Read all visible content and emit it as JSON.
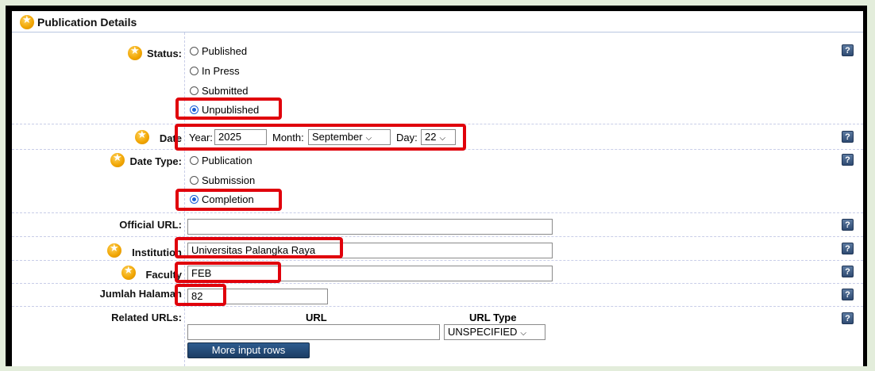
{
  "panel": {
    "title": "Publication Details"
  },
  "fields": {
    "status": {
      "label": "Status:",
      "options": [
        "Published",
        "In Press",
        "Submitted",
        "Unpublished"
      ],
      "selected": "Unpublished"
    },
    "date": {
      "label": "Date",
      "year_label": "Year:",
      "year_value": "2025",
      "month_label": "Month:",
      "month_value": "September",
      "day_label": "Day:",
      "day_value": "22"
    },
    "date_type": {
      "label": "Date Type:",
      "options": [
        "Publication",
        "Submission",
        "Completion"
      ],
      "selected": "Completion"
    },
    "official_url": {
      "label": "Official URL:",
      "value": ""
    },
    "institution": {
      "label": "Institution",
      "value": "Universitas Palangka Raya"
    },
    "faculty": {
      "label": "Faculty",
      "value": "FEB"
    },
    "jumlah_halaman": {
      "label": "Jumlah Halaman",
      "value": "82"
    },
    "related_urls": {
      "label": "Related URLs:",
      "col_url": "URL",
      "col_type": "URL Type",
      "url_value": "",
      "type_value": "UNSPECIFIED",
      "more_button": "More input rows"
    }
  },
  "help_glyph": "?",
  "colors": {
    "highlight": "#e0000b",
    "button": "#1c3d64",
    "radio_selected": "#1a5fd6"
  }
}
